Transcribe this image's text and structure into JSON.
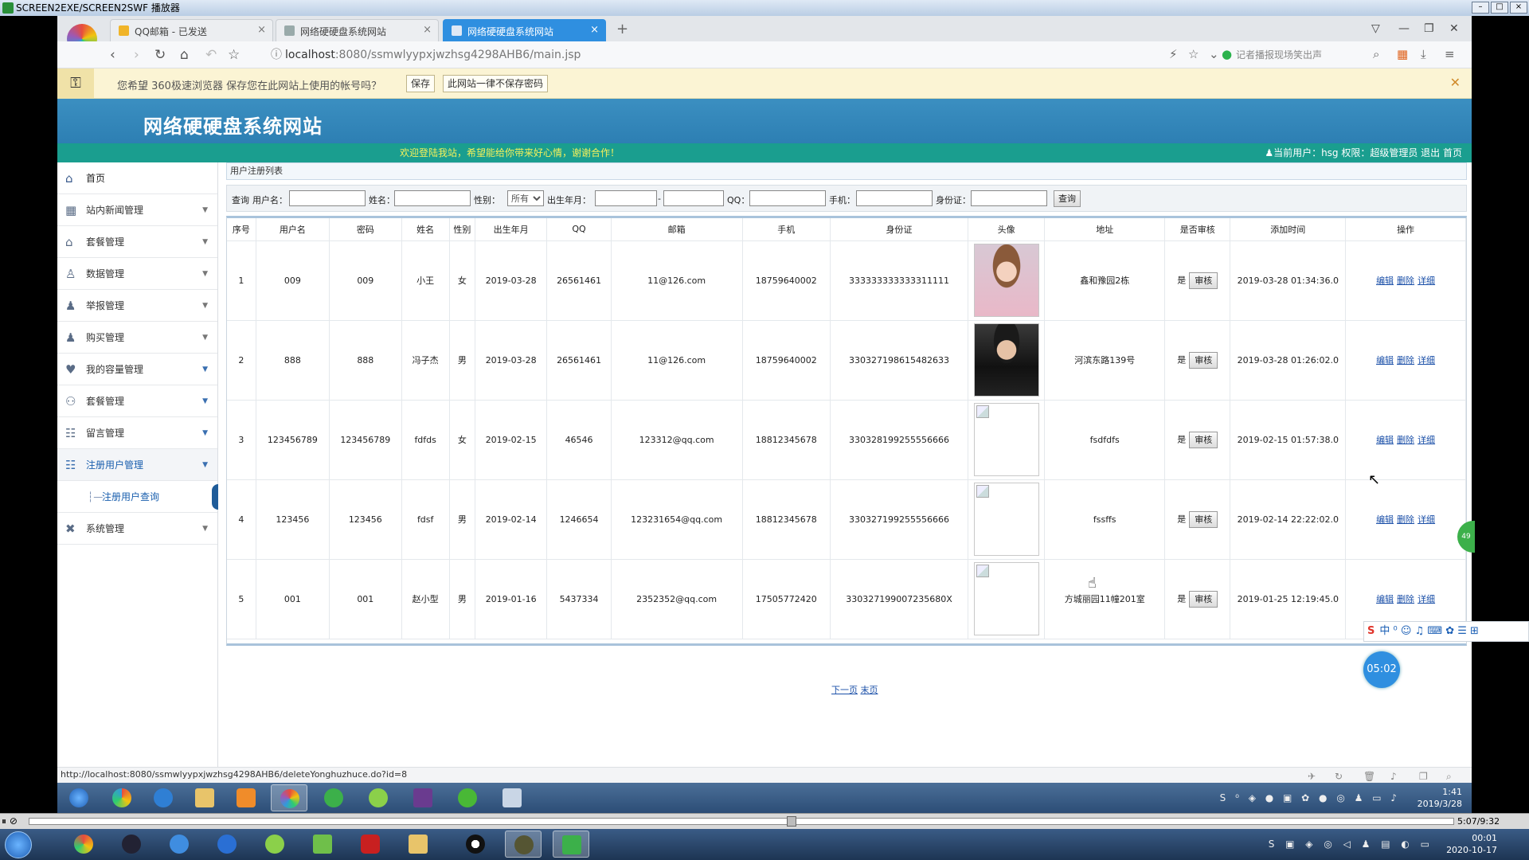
{
  "player": {
    "title": "SCREEN2EXE/SCREEN2SWF 播放器",
    "time": "5:07/9:32"
  },
  "browser": {
    "tabs": [
      {
        "label": "QQ邮箱 - 已发送"
      },
      {
        "label": "网络硬硬盘系统网站"
      },
      {
        "label": "网络硬硬盘系统网站"
      }
    ],
    "url_host": "localhost",
    "url_rest": ":8080/ssmwlyypxjwzhsg4298AHB6/main.jsp",
    "search_hint": "记者播报现场笑出声",
    "status_url": "http://localhost:8080/ssmwlyypxjwzhsg4298AHB6/deleteYonghuzhuce.do?id=8"
  },
  "password_bar": {
    "message": "您希望 360极速浏览器 保存您在此网站上使用的帐号吗？",
    "save_label": "保存",
    "never_label": "此网站一律不保存密码"
  },
  "site": {
    "title": "网络硬硬盘系统网站",
    "welcome": "欢迎登陆我站，希望能给你带来好心情，谢谢合作！",
    "user_info": "当前用户：hsg  权限：超级管理员  退出  首页"
  },
  "sidebar": {
    "items": [
      {
        "label": "首页",
        "icon": "home-icon"
      },
      {
        "label": "站内新闻管理",
        "icon": "grid-icon"
      },
      {
        "label": "套餐管理",
        "icon": "house-icon"
      },
      {
        "label": "数据管理",
        "icon": "users-icon"
      },
      {
        "label": "举报管理",
        "icon": "user-icon"
      },
      {
        "label": "购买管理",
        "icon": "user-icon"
      },
      {
        "label": "我的容量管理",
        "icon": "heart-icon"
      },
      {
        "label": "套餐管理",
        "icon": "group-icon"
      },
      {
        "label": "留言管理",
        "icon": "form-icon"
      },
      {
        "label": "注册用户管理",
        "icon": "form-icon"
      }
    ],
    "sub_item": "注册用户查询",
    "last_item": "系统管理"
  },
  "panel": {
    "title": "用户注册列表"
  },
  "filter": {
    "query_label": "查询",
    "username_label": "用户名：",
    "name_label": "姓名：",
    "gender_label": "性别：",
    "gender_value": "所有",
    "birth_label": "出生年月：",
    "birth_sep": "-",
    "qq_label": "QQ：",
    "phone_label": "手机：",
    "id_label": "身份证：",
    "search_button": "查询"
  },
  "table": {
    "headers": [
      "序号",
      "用户名",
      "密码",
      "姓名",
      "性别",
      "出生年月",
      "QQ",
      "邮箱",
      "手机",
      "身份证",
      "头像",
      "地址",
      "是否审核",
      "添加时间",
      "操作"
    ],
    "audit_button": "审核",
    "ops": [
      "编辑",
      "删除",
      "详细"
    ],
    "rows": [
      {
        "no": "1",
        "username": "009",
        "password": "009",
        "name": "小王",
        "gender": "女",
        "birth": "2019-03-28",
        "qq": "26561461",
        "email": "11@126.com",
        "phone": "18759640002",
        "idcard": "333333333333311111",
        "address": "鑫和豫园2栋",
        "audited": "是",
        "time": "2019-03-28 01:34:36.0"
      },
      {
        "no": "2",
        "username": "888",
        "password": "888",
        "name": "冯子杰",
        "gender": "男",
        "birth": "2019-03-28",
        "qq": "26561461",
        "email": "11@126.com",
        "phone": "18759640002",
        "idcard": "330327198615482633",
        "address": "河滨东路139号",
        "audited": "是",
        "time": "2019-03-28 01:26:02.0"
      },
      {
        "no": "3",
        "username": "123456789",
        "password": "123456789",
        "name": "fdfds",
        "gender": "女",
        "birth": "2019-02-15",
        "qq": "46546",
        "email": "123312@qq.com",
        "phone": "18812345678",
        "idcard": "330328199255556666",
        "address": "fsdfdfs",
        "audited": "是",
        "time": "2019-02-15 01:57:38.0"
      },
      {
        "no": "4",
        "username": "123456",
        "password": "123456",
        "name": "fdsf",
        "gender": "男",
        "birth": "2019-02-14",
        "qq": "1246654",
        "email": "123231654@qq.com",
        "phone": "18812345678",
        "idcard": "330327199255556666",
        "address": "fssffs",
        "audited": "是",
        "time": "2019-02-14 22:22:02.0"
      },
      {
        "no": "5",
        "username": "001",
        "password": "001",
        "name": "赵小型",
        "gender": "男",
        "birth": "2019-01-16",
        "qq": "5437334",
        "email": "2352352@qq.com",
        "phone": "17505772420",
        "idcard": "330327199007235680X",
        "address": "方城丽园11幢201室",
        "audited": "是",
        "time": "2019-01-25 12:19:45.0"
      }
    ]
  },
  "pager": {
    "next": "下一页",
    "last": "末页"
  },
  "widgets": {
    "timer": "05:02",
    "side_ball": "49"
  },
  "taskbar1": {
    "time": "1:41",
    "date": "2019/3/28"
  },
  "taskbar2": {
    "time": "00:01",
    "date": "2020-10-17"
  }
}
